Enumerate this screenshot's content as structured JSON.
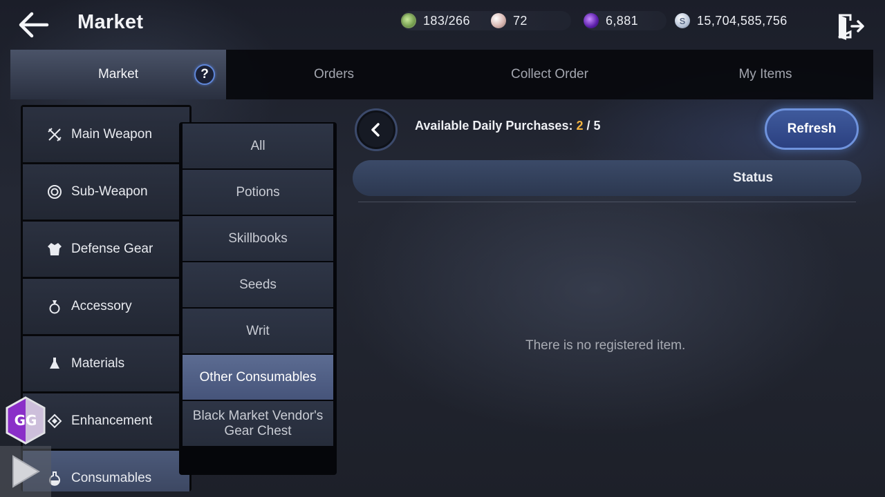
{
  "header": {
    "title": "Market",
    "currencies": {
      "energy": "183/266",
      "pearl": "72",
      "crystal": "6,881",
      "silver": "15,704,585,756"
    }
  },
  "tabs": [
    {
      "label": "Market",
      "active": true
    },
    {
      "label": "Orders",
      "active": false
    },
    {
      "label": "Collect Order",
      "active": false
    },
    {
      "label": "My Items",
      "active": false
    }
  ],
  "help": {
    "label": "?"
  },
  "categories": [
    {
      "label": "Main Weapon",
      "icon": "crossed-swords-icon"
    },
    {
      "label": "Sub-Weapon",
      "icon": "shield-ring-icon"
    },
    {
      "label": "Defense Gear",
      "icon": "armor-icon"
    },
    {
      "label": "Accessory",
      "icon": "ring-icon"
    },
    {
      "label": "Materials",
      "icon": "flask-icon"
    },
    {
      "label": "Enhancement",
      "icon": "enhance-diamond-icon"
    },
    {
      "label": "Consumables",
      "icon": "potion-icon",
      "active": true
    }
  ],
  "subcategories": [
    {
      "label": "All"
    },
    {
      "label": "Potions"
    },
    {
      "label": "Skillbooks"
    },
    {
      "label": "Seeds"
    },
    {
      "label": "Writ"
    },
    {
      "label": "Other Consumables",
      "active": true
    },
    {
      "label": "Black Market Vendor's Gear Chest"
    }
  ],
  "content": {
    "purchases_label": "Available Daily Purchases:",
    "purchases_count": "2",
    "purchases_sep": "/",
    "purchases_max": "5",
    "refresh_label": "Refresh",
    "status_header": "Status",
    "empty_message": "There is no registered item."
  },
  "overlay": {
    "gg_label": "GG"
  },
  "colors": {
    "accent": "#f2b340",
    "button_blue": "#3f5a9c",
    "active_tab": "#4a5368"
  }
}
